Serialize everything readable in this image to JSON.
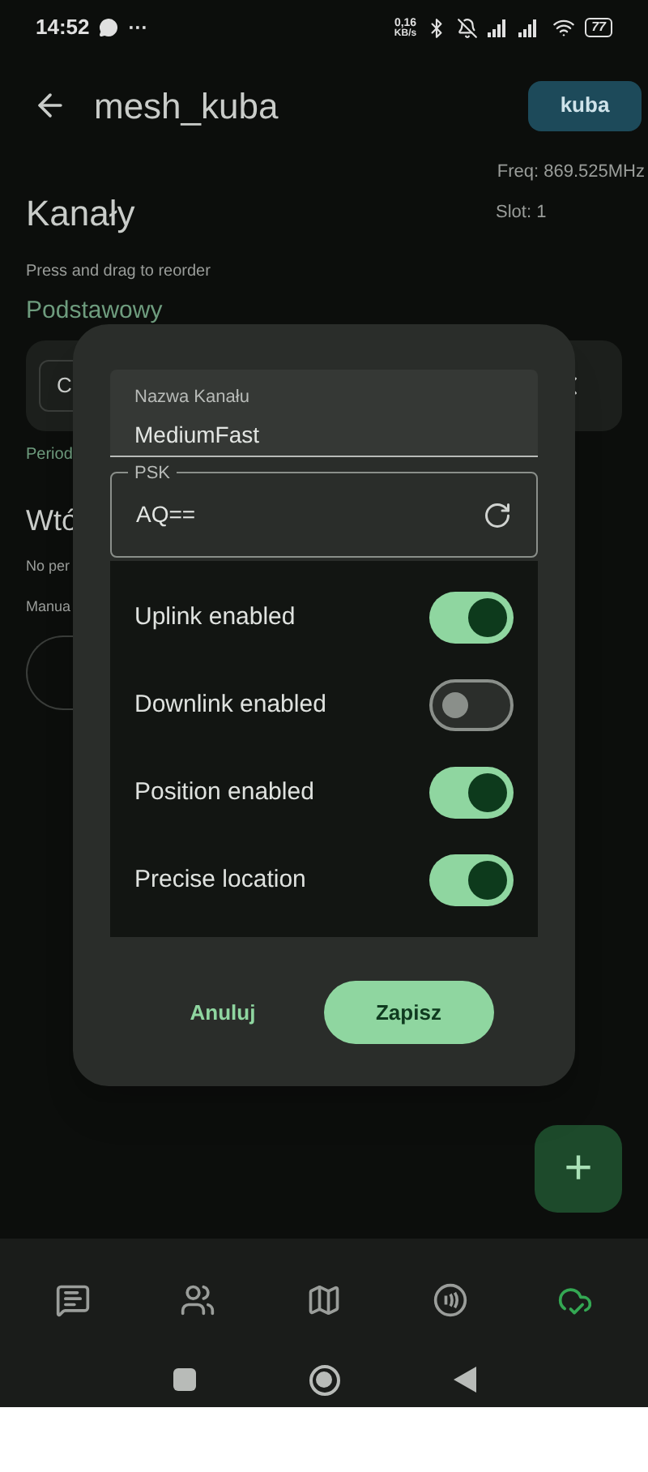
{
  "status_bar": {
    "time": "14:52",
    "more": "···",
    "speed_value": "0,16",
    "speed_unit": "KB/s",
    "battery": "77"
  },
  "header": {
    "title": "mesh_kuba",
    "profile_button": "kuba"
  },
  "radio": {
    "freq": "Freq: 869.525MHz",
    "slot": "Slot: 1"
  },
  "channels": {
    "title": "Kanały",
    "hint": "Press and drag to reorder",
    "primary_label": "Podstawowy",
    "channel_initial": "C",
    "period_text": "Period"
  },
  "secondary": {
    "title": "Wtó",
    "line_1": "No per",
    "line_2": "Manua"
  },
  "dialog": {
    "name_field": {
      "label": "Nazwa Kanału",
      "value": "MediumFast"
    },
    "psk_field": {
      "label": "PSK",
      "value": "AQ=="
    },
    "toggles": [
      {
        "label": "Uplink enabled",
        "on": true
      },
      {
        "label": "Downlink enabled",
        "on": false
      },
      {
        "label": "Position enabled",
        "on": true
      },
      {
        "label": "Precise location",
        "on": true
      }
    ],
    "cancel": "Anuluj",
    "save": "Zapisz"
  },
  "add_button": "+",
  "bottom_nav": [
    {
      "kind": "messages",
      "selected": false
    },
    {
      "kind": "contacts",
      "selected": false
    },
    {
      "kind": "map",
      "selected": false
    },
    {
      "kind": "radio",
      "selected": false
    },
    {
      "kind": "connection",
      "selected": true
    }
  ]
}
